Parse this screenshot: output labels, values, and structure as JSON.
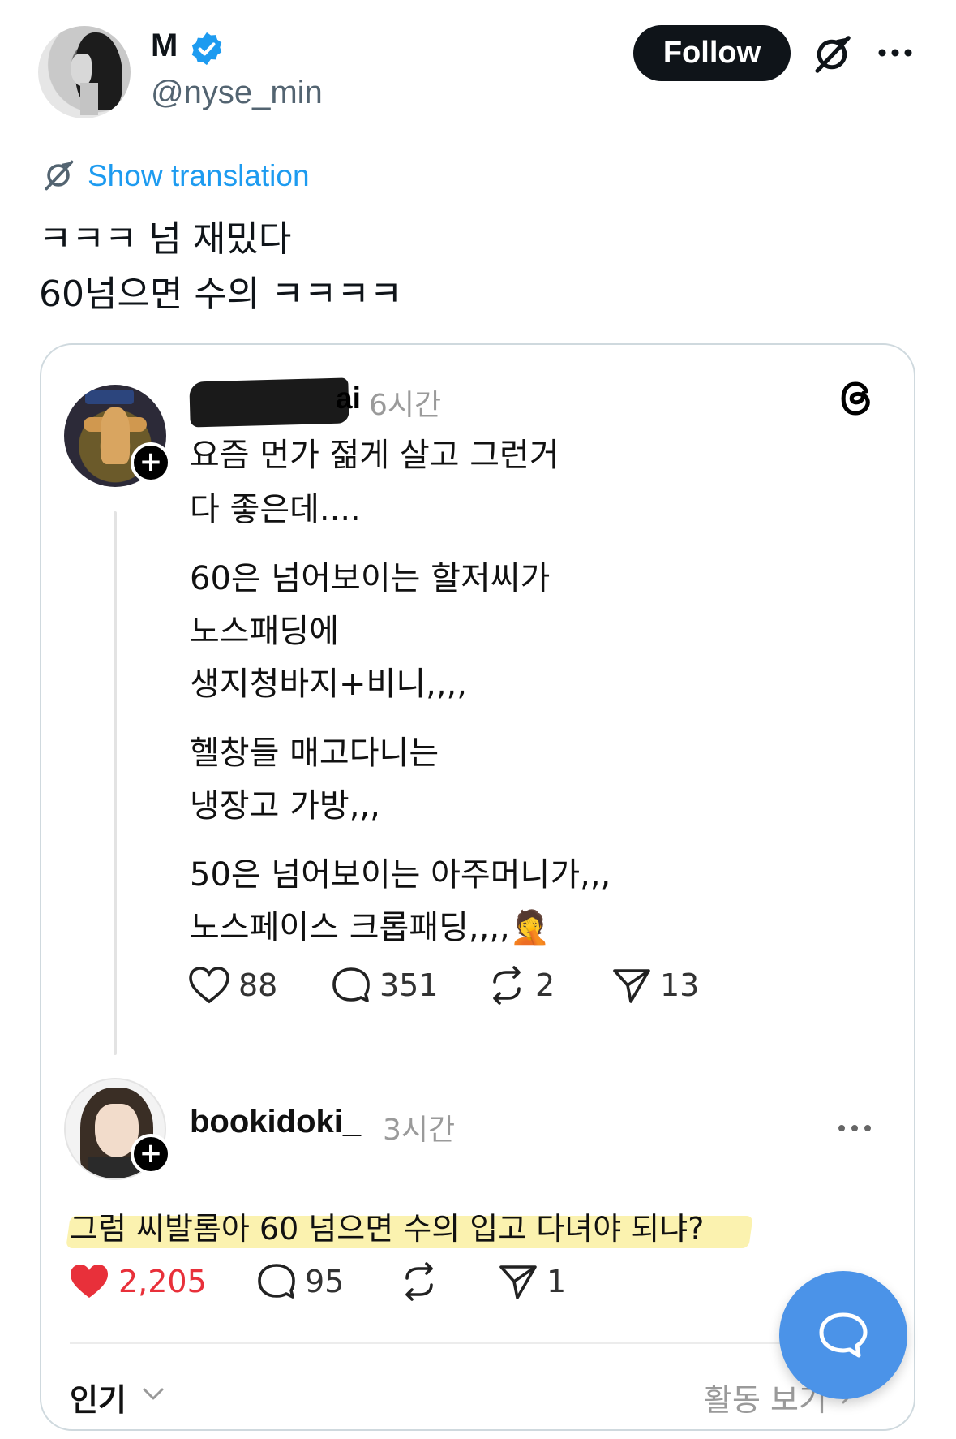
{
  "author": {
    "name": "M",
    "handle": "@nyse_min",
    "verified_icon": "verified-badge-icon"
  },
  "actions": {
    "follow_label": "Follow",
    "grok_icon": "grok-icon",
    "more_icon": "more-horizontal-icon"
  },
  "translation": {
    "label": "Show translation",
    "icon": "translate-icon"
  },
  "tweet": {
    "lines": [
      "ㅋㅋㅋ 넘 재밌다",
      "60넘으면 수의 ㅋㅋㅋㅋ"
    ]
  },
  "embedded_post": {
    "username_visible_suffix": "ai",
    "time": "6시간",
    "logo_icon": "threads-logo-icon",
    "body_lines": [
      "요즘 먼가 젊게 살고 그런거",
      "다 좋은데....",
      "60은 넘어보이는 할저씨가",
      "노스패딩에",
      "생지청바지+비니,,,,",
      "헬창들 매고다니는",
      "냉장고 가방,,,",
      "50은 넘어보이는 아주머니가,,,",
      "노스페이스 크롭패딩,,,,"
    ],
    "emoji": "🤦",
    "stats": {
      "likes": "88",
      "comments": "351",
      "reposts": "2",
      "shares": "13"
    }
  },
  "reply_post": {
    "username": "bookidoki_",
    "time": "3시간",
    "text": "그럼 씨발롬아 60 넘으면 수의 입고 다녀야 되냐?",
    "stats": {
      "likes": "2,205",
      "comments": "95",
      "shares": "1"
    }
  },
  "footer": {
    "sort_label": "인기",
    "activity_link": "활동 보기"
  },
  "colors": {
    "link_blue": "#1d9bf0",
    "like_red": "#e8303a",
    "fab_blue": "#4b93e8",
    "highlight_yellow": "#fbf1a6"
  }
}
